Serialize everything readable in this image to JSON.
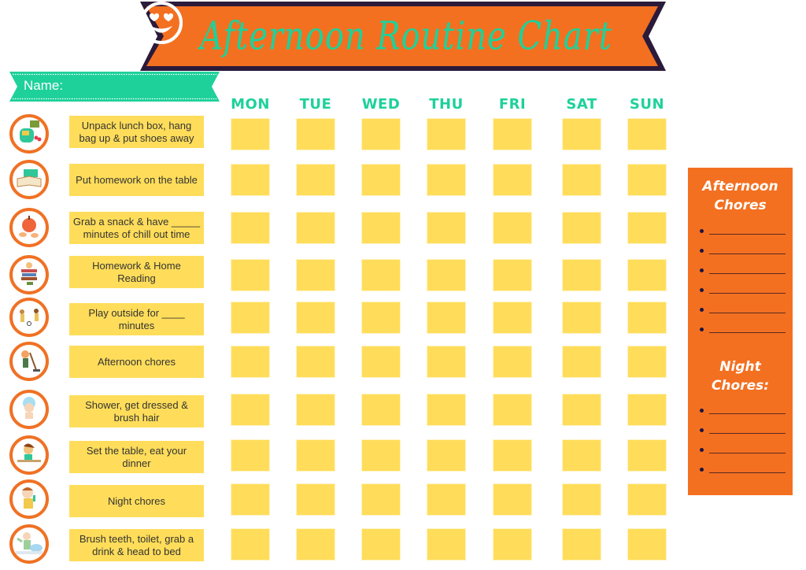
{
  "title": "Afternoon Routine Chart",
  "colors": {
    "orange": "#f37021",
    "teal": "#1ed19a",
    "yellow": "#ffdd5a",
    "ribbon_border": "#2b1a3a",
    "text": "#333333"
  },
  "name_banner": {
    "label": "Name:"
  },
  "days": [
    "MON",
    "TUE",
    "WED",
    "THU",
    "FRI",
    "SAT",
    "SUN"
  ],
  "tasks": [
    {
      "label": "Unpack lunch box, hang bag up & put shoes away",
      "icon": "backpack-icon"
    },
    {
      "label": "Put homework on the table",
      "icon": "books-icon"
    },
    {
      "label": "Grab a snack & have _____ minutes of chill out time",
      "icon": "apple-icon"
    },
    {
      "label": "Homework & Home Reading",
      "icon": "reading-stack-icon"
    },
    {
      "label": "Play outside for ____ minutes",
      "icon": "kids-playing-icon"
    },
    {
      "label": "Afternoon chores",
      "icon": "sweeping-icon"
    },
    {
      "label": "Shower, get dressed & brush hair",
      "icon": "shower-icon"
    },
    {
      "label": "Set the table, eat your dinner",
      "icon": "dinner-icon"
    },
    {
      "label": "Night chores",
      "icon": "child-icon"
    },
    {
      "label": "Brush teeth, toilet, grab a drink & head to bed",
      "icon": "bedtime-icon"
    }
  ],
  "chores_panel": {
    "afternoon_heading_line1": "Afternoon",
    "afternoon_heading_line2": "Chores",
    "afternoon_blank_count": 6,
    "night_heading_line1": "Night",
    "night_heading_line2": "Chores:",
    "night_blank_count": 4
  }
}
